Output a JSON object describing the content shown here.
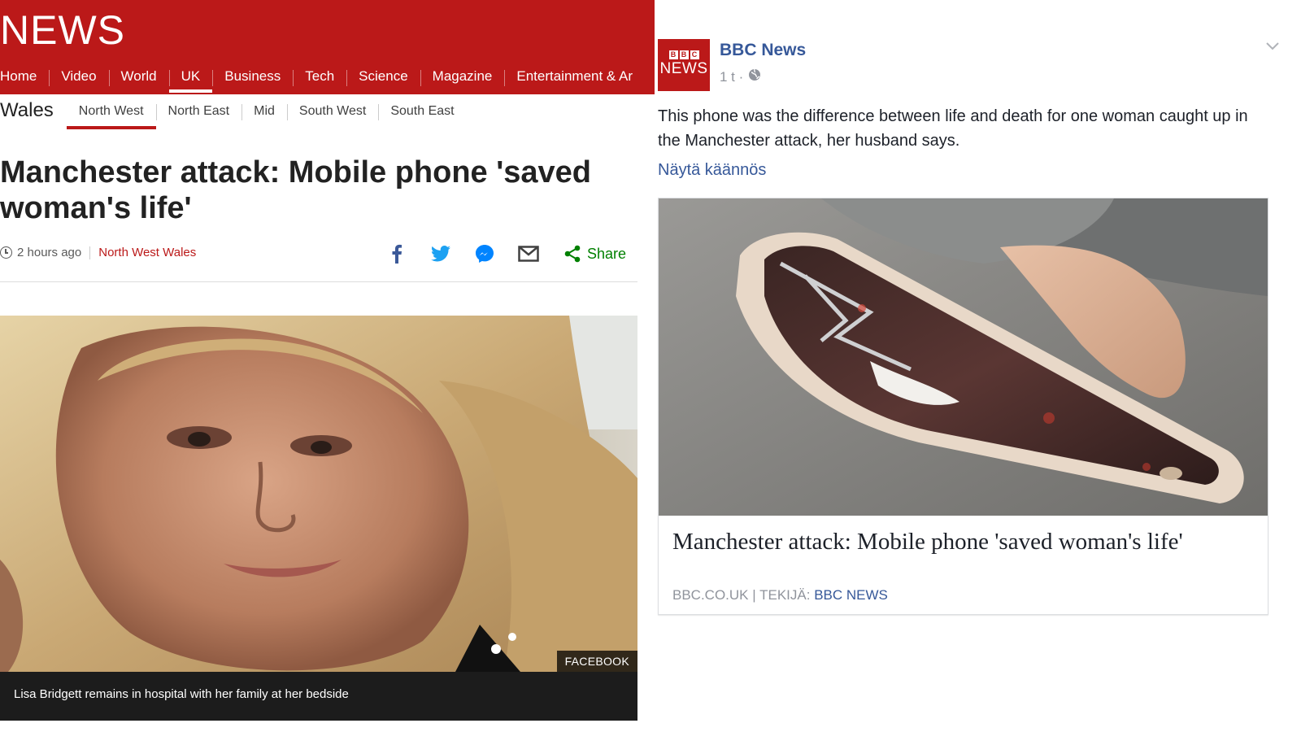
{
  "bbc": {
    "logo": "NEWS",
    "nav": [
      "Home",
      "Video",
      "World",
      "UK",
      "Business",
      "Tech",
      "Science",
      "Magazine",
      "Entertainment & Ar"
    ],
    "nav_active": "UK",
    "subnav_title": "Wales",
    "subnav": [
      "North West",
      "North East",
      "Mid",
      "South West",
      "South East"
    ],
    "subnav_active": "North West",
    "headline": "Manchester attack: Mobile phone 'saved woman's life'",
    "timestamp": "2 hours ago",
    "section": "North West Wales",
    "share_label": "Share",
    "photo_credit": "FACEBOOK",
    "caption": "Lisa Bridgett remains in hospital with her family at her bedside",
    "colors": {
      "brand_red": "#bb1919",
      "share_green": "#008000",
      "twitter": "#1da1f2",
      "facebook": "#3b5998",
      "messenger": "#0084ff"
    }
  },
  "facebook": {
    "page_name": "BBC News",
    "avatar_top": [
      "B",
      "B",
      "C"
    ],
    "avatar_bottom": "NEWS",
    "post_time": "1 t ·",
    "post_text": "This phone was the difference between life and death for one woman caught up in the Manchester attack, her husband says.",
    "translate_link": "Näytä käännös",
    "card_title": "Manchester attack: Mobile phone 'saved woman's life'",
    "card_domain": "BBC.CO.UK",
    "card_by_label": "TEKIJÄ:",
    "card_author": "BBC NEWS",
    "colors": {
      "link_blue": "#365899",
      "meta_gray": "#90949c"
    }
  }
}
